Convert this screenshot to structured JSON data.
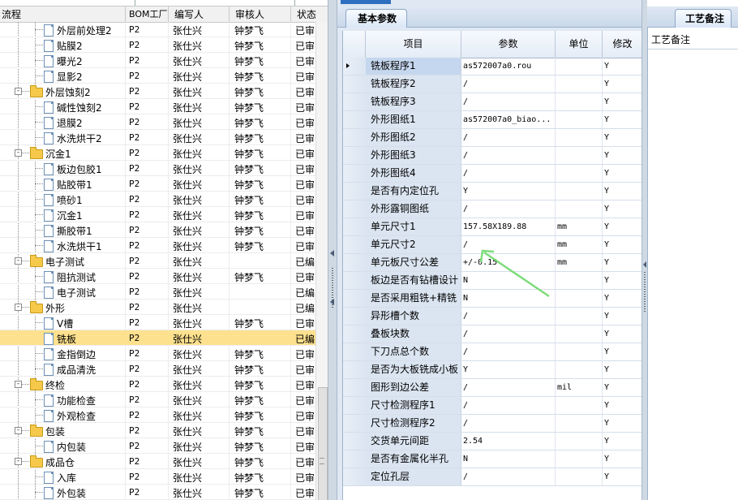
{
  "tree": {
    "columns": {
      "name": "流程",
      "bom": "BOM工厂",
      "author": "编写人",
      "reviewer": "审核人",
      "status": "状态"
    },
    "rows": [
      {
        "level": 2,
        "type": "doc",
        "name": "外层前处理2",
        "bom": "P2",
        "author": "张仕兴",
        "reviewer": "钟梦飞",
        "status": "已审"
      },
      {
        "level": 2,
        "type": "doc",
        "name": "贴膜2",
        "bom": "P2",
        "author": "张仕兴",
        "reviewer": "钟梦飞",
        "status": "已审"
      },
      {
        "level": 2,
        "type": "doc",
        "name": "曝光2",
        "bom": "P2",
        "author": "张仕兴",
        "reviewer": "钟梦飞",
        "status": "已审"
      },
      {
        "level": 2,
        "type": "doc",
        "name": "显影2",
        "bom": "P2",
        "author": "张仕兴",
        "reviewer": "钟梦飞",
        "status": "已审"
      },
      {
        "level": 1,
        "type": "folder",
        "name": "外层蚀刻2",
        "bom": "P2",
        "author": "张仕兴",
        "reviewer": "钟梦飞",
        "status": "已审"
      },
      {
        "level": 2,
        "type": "doc",
        "name": "碱性蚀刻2",
        "bom": "P2",
        "author": "张仕兴",
        "reviewer": "钟梦飞",
        "status": "已审"
      },
      {
        "level": 2,
        "type": "doc",
        "name": "退膜2",
        "bom": "P2",
        "author": "张仕兴",
        "reviewer": "钟梦飞",
        "status": "已审"
      },
      {
        "level": 2,
        "type": "doc",
        "name": "水洗烘干2",
        "bom": "P2",
        "author": "张仕兴",
        "reviewer": "钟梦飞",
        "status": "已审"
      },
      {
        "level": 1,
        "type": "folder",
        "name": "沉金1",
        "bom": "P2",
        "author": "张仕兴",
        "reviewer": "钟梦飞",
        "status": "已审"
      },
      {
        "level": 2,
        "type": "doc",
        "name": "板边包胶1",
        "bom": "P2",
        "author": "张仕兴",
        "reviewer": "钟梦飞",
        "status": "已审"
      },
      {
        "level": 2,
        "type": "doc",
        "name": "贴胶带1",
        "bom": "P2",
        "author": "张仕兴",
        "reviewer": "钟梦飞",
        "status": "已审"
      },
      {
        "level": 2,
        "type": "doc",
        "name": "喷砂1",
        "bom": "P2",
        "author": "张仕兴",
        "reviewer": "钟梦飞",
        "status": "已审"
      },
      {
        "level": 2,
        "type": "doc",
        "name": "沉金1",
        "bom": "P2",
        "author": "张仕兴",
        "reviewer": "钟梦飞",
        "status": "已审"
      },
      {
        "level": 2,
        "type": "doc",
        "name": "撕胶带1",
        "bom": "P2",
        "author": "张仕兴",
        "reviewer": "钟梦飞",
        "status": "已审"
      },
      {
        "level": 2,
        "type": "doc",
        "name": "水洗烘干1",
        "bom": "P2",
        "author": "张仕兴",
        "reviewer": "钟梦飞",
        "status": "已审"
      },
      {
        "level": 1,
        "type": "folder",
        "name": "电子测试",
        "bom": "P2",
        "author": "张仕兴",
        "reviewer": "",
        "status": "已编"
      },
      {
        "level": 2,
        "type": "doc",
        "name": "阻抗测试",
        "bom": "P2",
        "author": "张仕兴",
        "reviewer": "钟梦飞",
        "status": "已审"
      },
      {
        "level": 2,
        "type": "doc",
        "name": "电子测试",
        "bom": "P2",
        "author": "张仕兴",
        "reviewer": "",
        "status": "已编"
      },
      {
        "level": 1,
        "type": "folder",
        "name": "外形",
        "bom": "P2",
        "author": "张仕兴",
        "reviewer": "",
        "status": "已编"
      },
      {
        "level": 2,
        "type": "doc",
        "name": "V槽",
        "bom": "P2",
        "author": "张仕兴",
        "reviewer": "钟梦飞",
        "status": "已审"
      },
      {
        "level": 2,
        "type": "doc",
        "name": "铣板",
        "bom": "P2",
        "author": "张仕兴",
        "reviewer": "",
        "status": "已编",
        "selected": true
      },
      {
        "level": 2,
        "type": "doc",
        "name": "金指倒边",
        "bom": "P2",
        "author": "张仕兴",
        "reviewer": "钟梦飞",
        "status": "已审"
      },
      {
        "level": 2,
        "type": "doc",
        "name": "成品清洗",
        "bom": "P2",
        "author": "张仕兴",
        "reviewer": "钟梦飞",
        "status": "已审"
      },
      {
        "level": 1,
        "type": "folder",
        "name": "终检",
        "bom": "P2",
        "author": "张仕兴",
        "reviewer": "钟梦飞",
        "status": "已审"
      },
      {
        "level": 2,
        "type": "doc",
        "name": "功能检查",
        "bom": "P2",
        "author": "张仕兴",
        "reviewer": "钟梦飞",
        "status": "已审"
      },
      {
        "level": 2,
        "type": "doc",
        "name": "外观检查",
        "bom": "P2",
        "author": "张仕兴",
        "reviewer": "钟梦飞",
        "status": "已审"
      },
      {
        "level": 1,
        "type": "folder",
        "name": "包装",
        "bom": "P2",
        "author": "张仕兴",
        "reviewer": "钟梦飞",
        "status": "已审"
      },
      {
        "level": 2,
        "type": "doc",
        "name": "内包装",
        "bom": "P2",
        "author": "张仕兴",
        "reviewer": "钟梦飞",
        "status": "已审"
      },
      {
        "level": 1,
        "type": "folder",
        "name": "成品仓",
        "bom": "P2",
        "author": "张仕兴",
        "reviewer": "钟梦飞",
        "status": "已审"
      },
      {
        "level": 2,
        "type": "doc",
        "name": "入库",
        "bom": "P2",
        "author": "张仕兴",
        "reviewer": "钟梦飞",
        "status": "已审"
      },
      {
        "level": 2,
        "type": "doc",
        "name": "外包装",
        "bom": "P2",
        "author": "张仕兴",
        "reviewer": "钟梦飞",
        "status": "已审"
      }
    ]
  },
  "params_panel": {
    "tab_label": "基本参数",
    "columns": {
      "item": "项目",
      "param": "参数",
      "unit": "单位",
      "modify": "修改"
    },
    "rows": [
      {
        "item": "铣板程序1",
        "param": "as572007a0.rou",
        "unit": "",
        "modify": "Y"
      },
      {
        "item": "铣板程序2",
        "param": "/",
        "unit": "",
        "modify": "Y"
      },
      {
        "item": "铣板程序3",
        "param": "/",
        "unit": "",
        "modify": "Y"
      },
      {
        "item": "外形图纸1",
        "param": "as572007a0_biao...",
        "unit": "",
        "modify": "Y"
      },
      {
        "item": "外形图纸2",
        "param": "/",
        "unit": "",
        "modify": "Y"
      },
      {
        "item": "外形图纸3",
        "param": "/",
        "unit": "",
        "modify": "Y"
      },
      {
        "item": "外形图纸4",
        "param": "/",
        "unit": "",
        "modify": "Y"
      },
      {
        "item": "是否有内定位孔",
        "param": "Y",
        "unit": "",
        "modify": "Y"
      },
      {
        "item": "外形露铜图纸",
        "param": "/",
        "unit": "",
        "modify": "Y"
      },
      {
        "item": "单元尺寸1",
        "param": "157.58X189.88",
        "unit": "mm",
        "modify": "Y"
      },
      {
        "item": "单元尺寸2",
        "param": "/",
        "unit": "mm",
        "modify": "Y"
      },
      {
        "item": "单元板尺寸公差",
        "param": "+/-0.15",
        "unit": "mm",
        "modify": "Y"
      },
      {
        "item": "板边是否有钻槽设计",
        "param": "N",
        "unit": "",
        "modify": "Y"
      },
      {
        "item": "是否采用粗铣+精铣",
        "param": "N",
        "unit": "",
        "modify": "Y"
      },
      {
        "item": "异形槽个数",
        "param": "/",
        "unit": "",
        "modify": "Y"
      },
      {
        "item": "叠板块数",
        "param": "/",
        "unit": "",
        "modify": "Y"
      },
      {
        "item": "下刀点总个数",
        "param": "/",
        "unit": "",
        "modify": "Y"
      },
      {
        "item": "是否为大板铣成小板",
        "param": "Y",
        "unit": "",
        "modify": "Y"
      },
      {
        "item": "图形到边公差",
        "param": "/",
        "unit": "mil",
        "modify": "Y"
      },
      {
        "item": "尺寸检测程序1",
        "param": "/",
        "unit": "",
        "modify": "Y"
      },
      {
        "item": "尺寸检测程序2",
        "param": "/",
        "unit": "",
        "modify": "Y"
      },
      {
        "item": "交货单元间距",
        "param": "2.54",
        "unit": "",
        "modify": "Y"
      },
      {
        "item": "是否有金属化半孔",
        "param": "N",
        "unit": "",
        "modify": "Y"
      },
      {
        "item": "定位孔层",
        "param": "/",
        "unit": "",
        "modify": "Y"
      }
    ]
  },
  "notes_panel": {
    "tab_label": "工艺备注",
    "field_label": "工艺备注"
  },
  "colors": {
    "selected_row": "#fde18e",
    "panel_bg": "#dfe8f3",
    "annotation_arrow": "#7ddc7a"
  }
}
